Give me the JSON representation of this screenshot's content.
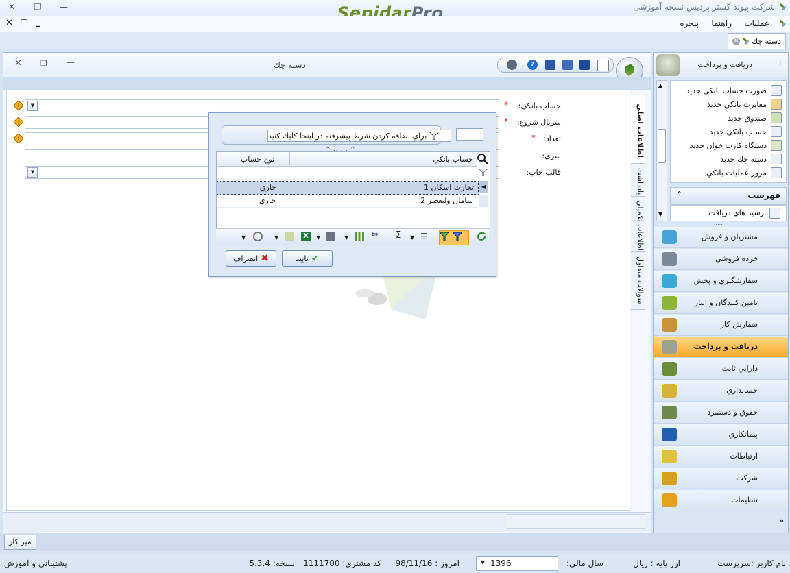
{
  "app": {
    "title": "شرکت پیوند گستر پردیس نسخه آموزشی",
    "logo": "SepidarPro"
  },
  "menu": {
    "items": [
      "عملیات",
      "راهنما",
      "پنجره"
    ]
  },
  "doc_tab": {
    "label": "دسته چك"
  },
  "window": {
    "title": "دسته چك"
  },
  "form": {
    "labels": {
      "bank_account": "حساب بانكي:",
      "serial_start": "سريال شروع:",
      "count": "تعداد:",
      "series": "سري:",
      "print_template": "قالب چاپ:"
    },
    "required_mark": "*"
  },
  "vertical_tabs": [
    "اطلاعات اصلي",
    "يادداشت",
    "اطلاعات تكميلي",
    "سوالات متداول"
  ],
  "popup": {
    "filter_text": "براي اضافه كردن شرط پيشرفته در اينجا كليك كنيد",
    "columns": [
      "حساب بانكي",
      "نوع حساب"
    ],
    "rows": [
      {
        "account": "تجارت اسكان 1",
        "type": "جاري"
      },
      {
        "account": "سامان وليعصر 2",
        "type": "جاري"
      }
    ],
    "ok_label": "تاييد",
    "cancel_label": "انصراف"
  },
  "sidebar": {
    "title": "دريافت و پرداخت",
    "items": [
      "صورت حساب بانكي جديد",
      "مغايرت بانكي جديد",
      "صندوق جديد",
      "حساب بانكي جديد",
      "دستگاه كارت خوان جديد",
      "دسته چك جديد",
      "مرور عمليات بانكي"
    ],
    "section_title": "فهرست",
    "section_item": "رسيد هاي دريافت",
    "nav": [
      "مشتريان و فروش",
      "خرده فروشي",
      "سفارشگيري و پخش",
      "تامين كنندگان و انبار",
      "سفارش كار",
      "دريافت و پرداخت",
      "دارايي ثابت",
      "حسابداري",
      "حقوق و دستمزد",
      "پيمانكاري",
      "ارتباطات",
      "شركت",
      "تنظيمات"
    ],
    "active_nav": "دريافت و پرداخت"
  },
  "bottom": {
    "desk_label": "ميز كار"
  },
  "status": {
    "user": "نام كاربر :سرپرست",
    "base_currency": "ارز پايه : ريال",
    "fiscal_year_label": "سال مالي:",
    "fiscal_year": "1396",
    "today": "امروز : 98/11/16",
    "customer_code": "كد مشتري: 1111700",
    "version": "نسخه: 5.3.4",
    "support": "پشتيباني و آموزش"
  }
}
